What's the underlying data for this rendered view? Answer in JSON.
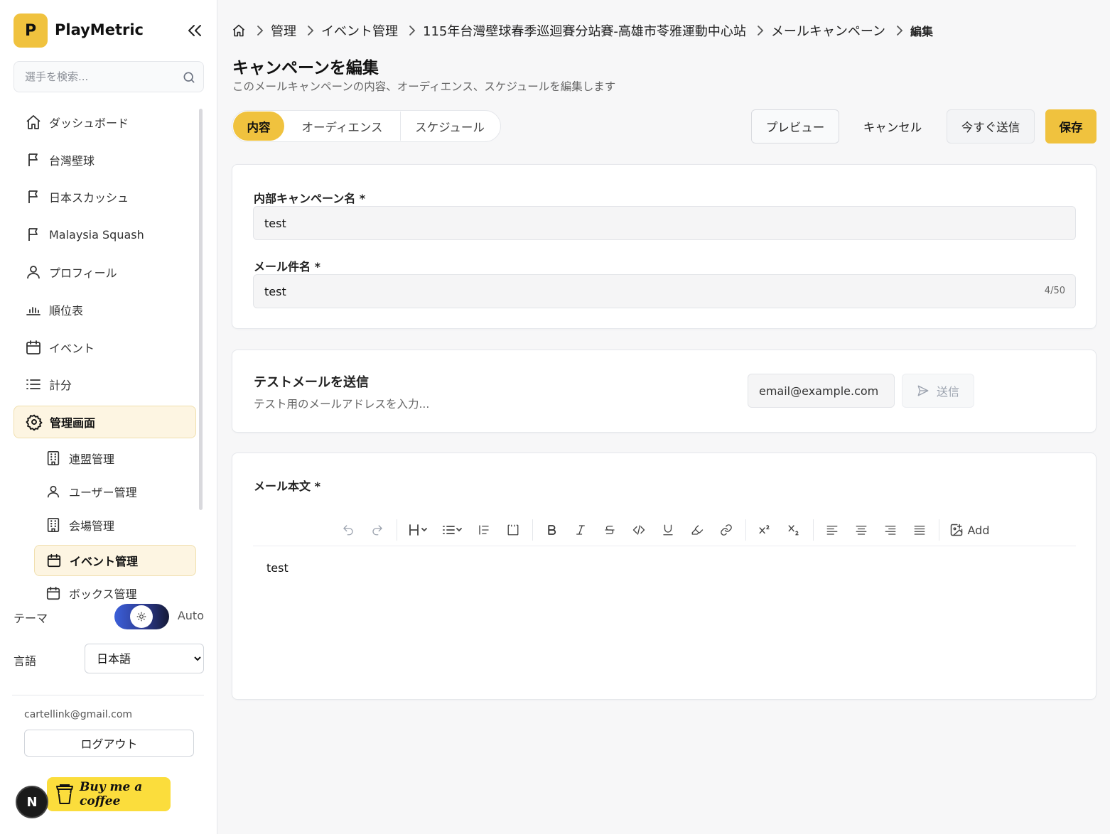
{
  "app": {
    "logo_letter": "P",
    "name": "PlayMetric"
  },
  "search": {
    "placeholder": "選手を検索..."
  },
  "nav": {
    "items": [
      {
        "label": "ダッシュボード",
        "icon": "home-icon"
      },
      {
        "label": "台灣壁球",
        "icon": "flag-icon"
      },
      {
        "label": "日本スカッシュ",
        "icon": "flag-icon"
      },
      {
        "label": "Malaysia Squash",
        "icon": "flag-icon"
      },
      {
        "label": "プロフィール",
        "icon": "user-icon"
      },
      {
        "label": "順位表",
        "icon": "bar-chart-icon"
      },
      {
        "label": "イベント",
        "icon": "calendar-icon"
      },
      {
        "label": "計分",
        "icon": "list-icon"
      },
      {
        "label": "管理画面",
        "icon": "gear-icon",
        "active": true
      }
    ],
    "sub_items": [
      {
        "label": "連盟管理",
        "icon": "building-icon"
      },
      {
        "label": "ユーザー管理",
        "icon": "user-icon"
      },
      {
        "label": "会場管理",
        "icon": "building-icon"
      },
      {
        "label": "イベント管理",
        "icon": "calendar-icon",
        "active": true
      },
      {
        "label": "ボックス管理",
        "icon": "calendar-icon"
      }
    ]
  },
  "theme": {
    "label": "テーマ",
    "value": "Auto"
  },
  "language": {
    "label": "言語",
    "selected": "日本語"
  },
  "user": {
    "email": "cartellink@gmail.com",
    "logout": "ログアウト"
  },
  "badges": {
    "next": "N",
    "coffee": "Buy me a coffee"
  },
  "breadcrumb": [
    "管理",
    "イベント管理",
    "115年台灣壁球春季巡迴賽分站賽-高雄市苓雅運動中心站",
    "メールキャンペーン",
    "編集"
  ],
  "page": {
    "title": "キャンペーンを編集",
    "subtitle": "このメールキャンペーンの内容、オーディエンス、スケジュールを編集します"
  },
  "tabs": [
    "内容",
    "オーディエンス",
    "スケジュール"
  ],
  "actions": {
    "preview": "プレビュー",
    "cancel": "キャンセル",
    "send_now": "今すぐ送信",
    "save": "保存"
  },
  "form": {
    "internal_name_label": "内部キャンペーン名 *",
    "internal_name_value": "test",
    "subject_label": "メール件名 *",
    "subject_value": "test",
    "subject_count": "4/50"
  },
  "test_email": {
    "title": "テストメールを送信",
    "subtitle": "テスト用のメールアドレスを入力...",
    "placeholder": "email@example.com",
    "send": "送信"
  },
  "body": {
    "label": "メール本文 *",
    "content": "test",
    "toolbar_add": "Add"
  },
  "colors": {
    "accent": "#f0c23e",
    "active_bg": "#fdf5e2"
  }
}
